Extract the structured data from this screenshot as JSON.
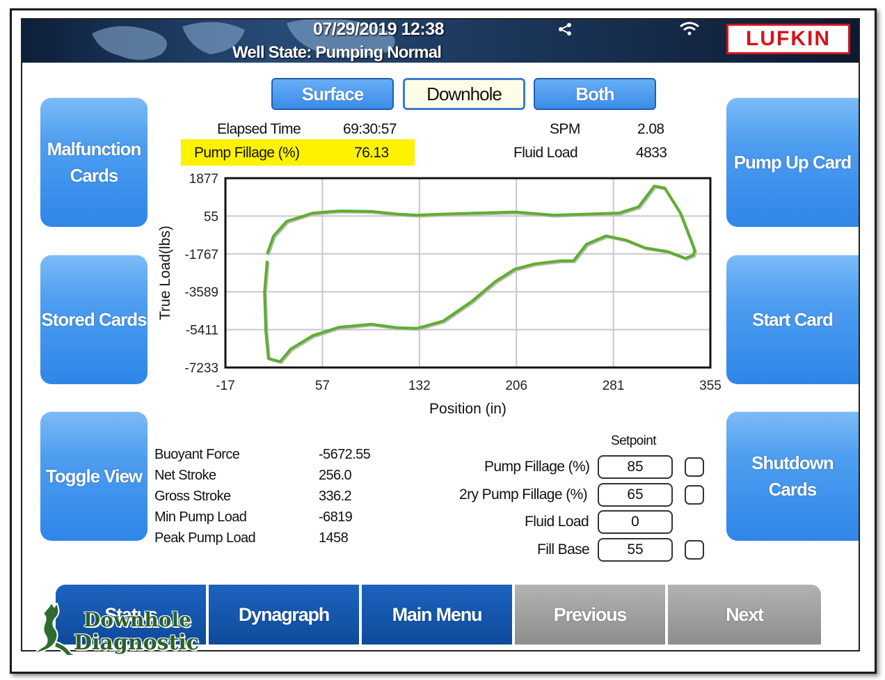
{
  "header": {
    "datetime": "07/29/2019 12:38",
    "well_state": "Well State: Pumping Normal",
    "brand_logo": "LUFKIN",
    "icons": [
      "share-icon",
      "wifi-icon"
    ]
  },
  "tabs": [
    {
      "label": "Surface",
      "active": false
    },
    {
      "label": "Downhole",
      "active": true
    },
    {
      "label": "Both",
      "active": false
    }
  ],
  "left_buttons": [
    "Malfunction\nCards",
    "Stored Cards",
    "Toggle View"
  ],
  "right_buttons": [
    "Pump Up Card",
    "Start Card",
    "Shutdown\nCards"
  ],
  "stats": {
    "elapsed_time_label": "Elapsed Time",
    "elapsed_time_value": "69:30:57",
    "spm_label": "SPM",
    "spm_value": "2.08",
    "pump_fillage_label": "Pump Fillage (%)",
    "pump_fillage_value": "76.13",
    "fluid_load_label": "Fluid Load",
    "fluid_load_value": "4833",
    "highlight_color": "#fff200"
  },
  "chart_data": {
    "type": "line",
    "xlabel": "Position (in)",
    "ylabel": "True Load(lbs)",
    "xlim": [
      -17,
      355
    ],
    "ylim": [
      -7233,
      1877
    ],
    "x_ticks": [
      "-17",
      "57",
      "132",
      "206",
      "281",
      "355"
    ],
    "y_ticks": [
      "1877",
      "55",
      "-1767",
      "-3589",
      "-5411",
      "-7233"
    ],
    "grid": true,
    "series": [
      {
        "color": "#5fae2e",
        "x": [
          15,
          20,
          30,
          50,
          70,
          95,
          115,
          130,
          150,
          175,
          205,
          235,
          260,
          285,
          300,
          312,
          320,
          332,
          340,
          343,
          342,
          336,
          322,
          305,
          290,
          275,
          260,
          250,
          240,
          220,
          205,
          190,
          172,
          150,
          130,
          115,
          95,
          70,
          50,
          33,
          25,
          16,
          14,
          13,
          15
        ],
        "y": [
          -1767,
          -900,
          -200,
          200,
          300,
          280,
          150,
          100,
          150,
          200,
          250,
          100,
          150,
          200,
          500,
          1500,
          1400,
          200,
          -1100,
          -1600,
          -1820,
          -1980,
          -1650,
          -1480,
          -1100,
          -900,
          -1300,
          -2100,
          -2100,
          -2250,
          -2500,
          -3100,
          -4050,
          -5000,
          -5350,
          -5320,
          -5150,
          -5300,
          -5700,
          -6350,
          -6950,
          -6800,
          -5500,
          -3600,
          -2100
        ]
      }
    ]
  },
  "details": [
    {
      "label": "Buoyant Force",
      "value": "-5672.55"
    },
    {
      "label": "Net Stroke",
      "value": "256.0"
    },
    {
      "label": "Gross Stroke",
      "value": "336.2"
    },
    {
      "label": "Min Pump Load",
      "value": "-6819"
    },
    {
      "label": "Peak Pump Load",
      "value": "1458"
    }
  ],
  "setpoints": {
    "title": "Setpoint",
    "rows": [
      {
        "label": "Pump Fillage (%)",
        "value": "85",
        "checkbox": true
      },
      {
        "label": "2ry Pump Fillage (%)",
        "value": "65",
        "checkbox": true
      },
      {
        "label": "Fluid Load",
        "value": "0",
        "checkbox": false
      },
      {
        "label": "Fill Base",
        "value": "55",
        "checkbox": true
      }
    ]
  },
  "bottom_nav": [
    {
      "label": "Status",
      "enabled": true
    },
    {
      "label": "Dynagraph",
      "enabled": true
    },
    {
      "label": "Main Menu",
      "enabled": true
    },
    {
      "label": "Previous",
      "enabled": false
    },
    {
      "label": "Next",
      "enabled": false
    }
  ],
  "watermark": {
    "line1": "Downhole",
    "line2": "Diagnostic"
  }
}
